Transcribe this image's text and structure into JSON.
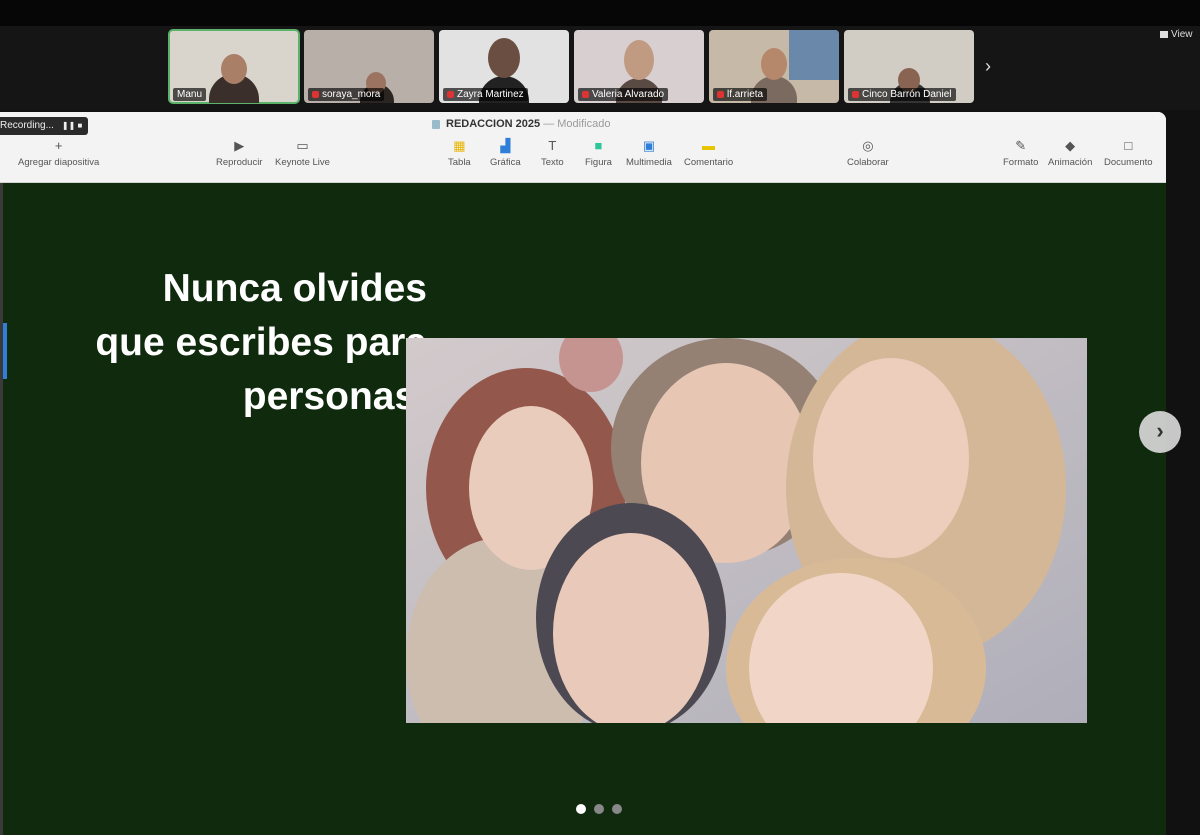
{
  "meeting": {
    "view_label": "View",
    "participants": [
      {
        "name": "Manu"
      },
      {
        "name": "soraya_mora"
      },
      {
        "name": "Zayra Martinez"
      },
      {
        "name": "Valeria Alvarado"
      },
      {
        "name": "lf.arrieta"
      },
      {
        "name": "Cinco Barrón Daniel"
      }
    ],
    "recording_label": "Recording...",
    "recording_controls": "❚❚  ■"
  },
  "keynote": {
    "doc_title": "REDACCION 2025",
    "doc_status": "— Modificado",
    "toolbar": {
      "add_slide": "Agregar diapositiva",
      "play": "Reproducir",
      "keynote_live": "Keynote Live",
      "table": "Tabla",
      "chart": "Gráfica",
      "text": "Texto",
      "shape": "Figura",
      "media": "Multimedia",
      "comment": "Comentario",
      "collaborate": "Colaborar",
      "format": "Formato",
      "animate": "Animación",
      "document": "Documento"
    },
    "icons": {
      "add_slide": "+",
      "play": "▶",
      "keynote_live": "▭",
      "table": "▦",
      "chart": "▟",
      "text": "T",
      "shape": "■",
      "media": "▣",
      "comment": "▬",
      "collaborate": "◎",
      "format": "✎",
      "animate": "◆",
      "document": "□"
    }
  },
  "slide": {
    "text_line1": "Nunca olvides",
    "text_line2": "que escribes para",
    "text_line3": "personas.",
    "background_color": "#0f2a0c",
    "next_glyph": "›",
    "page_count": 3,
    "current_page": 1
  }
}
